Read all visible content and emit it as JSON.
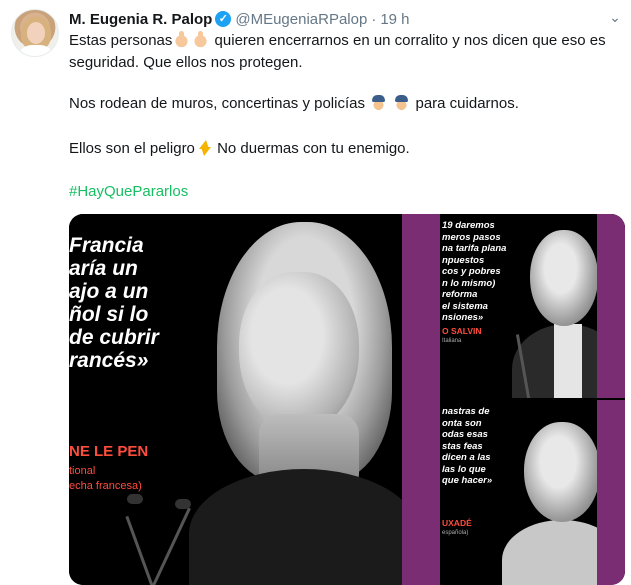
{
  "tweet": {
    "author_name": "M. Eugenia R. Palop",
    "verified_mark": "✓",
    "handle": "@MEugeniaRPalop",
    "separator": "·",
    "time": "19 h",
    "menu_icon": "chevron-down-icon",
    "line1_a": "Estas personas",
    "line1_b": " quieren encerrarnos en un corralito y nos dicen que eso es seguridad. Que ellos nos protegen.",
    "line2_a": "Nos rodean de muros, concertinas y policías",
    "line2_b": " para cuidarnos.",
    "line3_a": "Ellos son el peligro",
    "line3_b": " No duermas con tu enemigo.",
    "hashtag": "#HayQuePararlos",
    "link_color": "#17bf63"
  },
  "media": {
    "main": {
      "quote": "Francia\naría un\najo a un\nñol si lo\nde cubrir\nrancés»",
      "speaker": "NE LE PEN",
      "party": "tional\necha francesa)"
    },
    "top_right": {
      "quote": "19 daremos\nmeros pasos\nna tarifa plana\nnpuestos\ncos y pobres\nn lo mismo)\nreforma\nel sistema\nnsiones»",
      "speaker": "O SALVIN",
      "party": "Italiana"
    },
    "bottom_right": {
      "quote": "nastras de\nonta son\nodas esas\nstas feas\ndicen a las\nlas lo que\nque hacer»",
      "speaker": "UXADÉ",
      "party": "española)"
    },
    "accent_color": "#7b2d73",
    "name_color": "#ff4d3d"
  }
}
